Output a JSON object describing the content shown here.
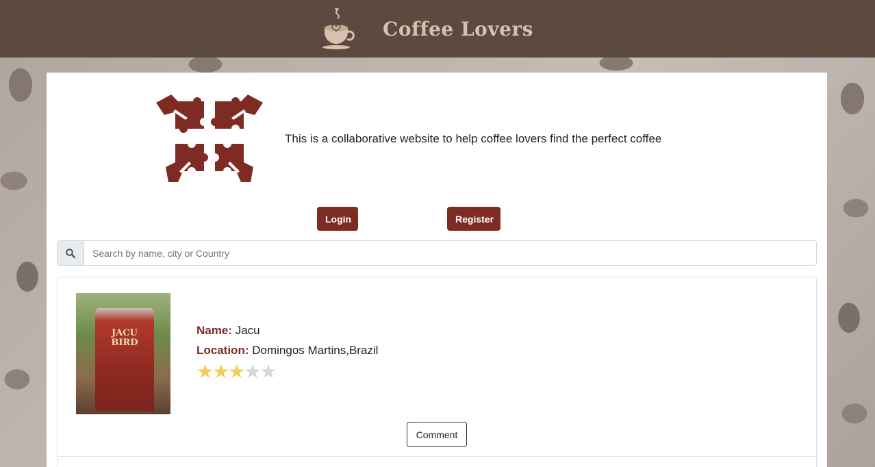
{
  "header": {
    "title": "Coffee Lovers",
    "logo_icon": "coffee-cup-heart-icon",
    "background_color": "#5c4940"
  },
  "intro": {
    "logo_icon": "puzzle-hands-icon",
    "text": "This is a collaborative website to help coffee lovers find the perfect coffee"
  },
  "auth": {
    "login_label": "Login",
    "register_label": "Register",
    "button_color": "#7d2b23"
  },
  "search": {
    "icon": "search-icon",
    "placeholder": "Search by name, city or Country",
    "value": ""
  },
  "coffees": [
    {
      "image_text_line1": "JACU",
      "image_text_line2": "BIRD",
      "name_label": "Name:",
      "name": "Jacu",
      "location_label": "Location:",
      "location": "Domingos Martins,Brazil",
      "rating": 3,
      "rating_max": 5,
      "comment_label": "Comment"
    }
  ]
}
